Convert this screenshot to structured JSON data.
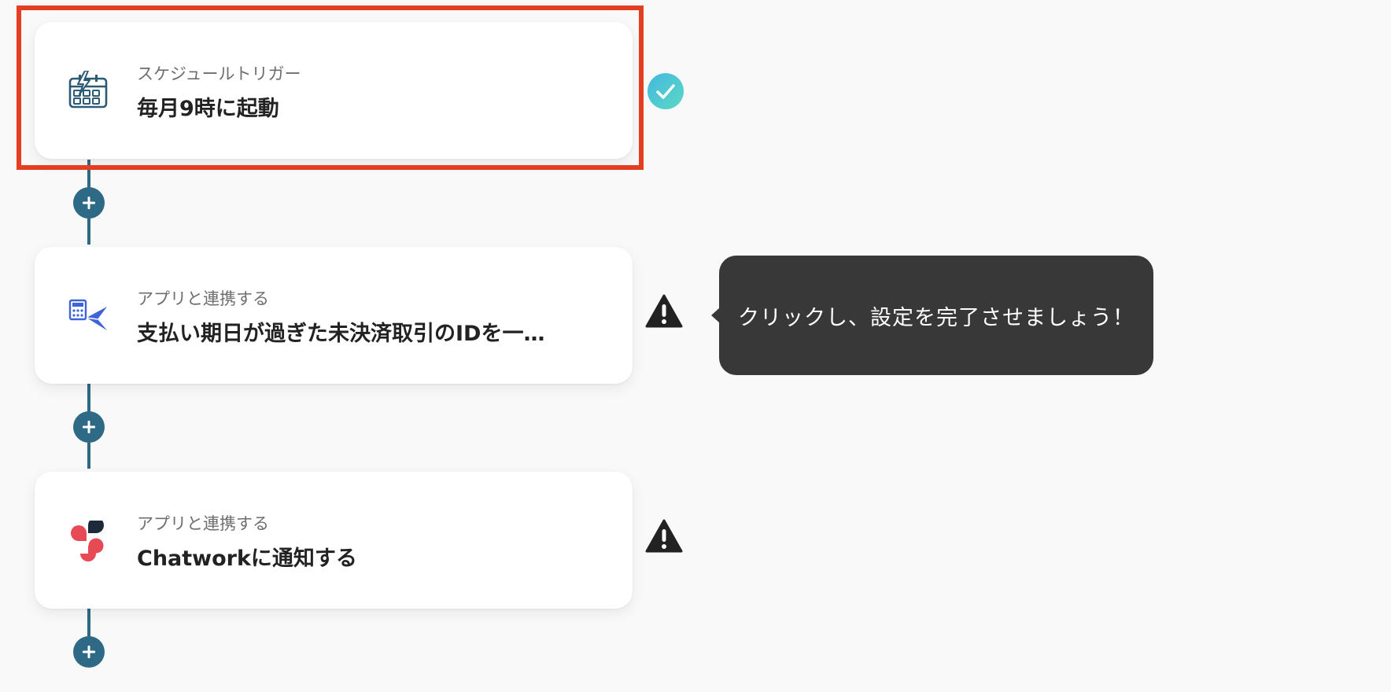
{
  "steps": [
    {
      "subtitle": "スケジュールトリガー",
      "title": "毎月9時に起動",
      "icon": "calendar-lightning-icon",
      "status": "complete"
    },
    {
      "subtitle": "アプリと連携する",
      "title": "支払い期日が過ぎた未決済取引のIDを一…",
      "icon": "accounting-app-icon",
      "status": "warning"
    },
    {
      "subtitle": "アプリと連携する",
      "title": "Chatworkに通知する",
      "icon": "chatwork-icon",
      "status": "warning"
    }
  ],
  "tooltip": {
    "text": "クリックし、設定を完了させましょう！"
  },
  "colors": {
    "accent": "#2e6a86",
    "highlight": "#e33d22",
    "complete": "#4fc3d6",
    "warning": "#222222",
    "tooltip_bg": "#383838"
  }
}
